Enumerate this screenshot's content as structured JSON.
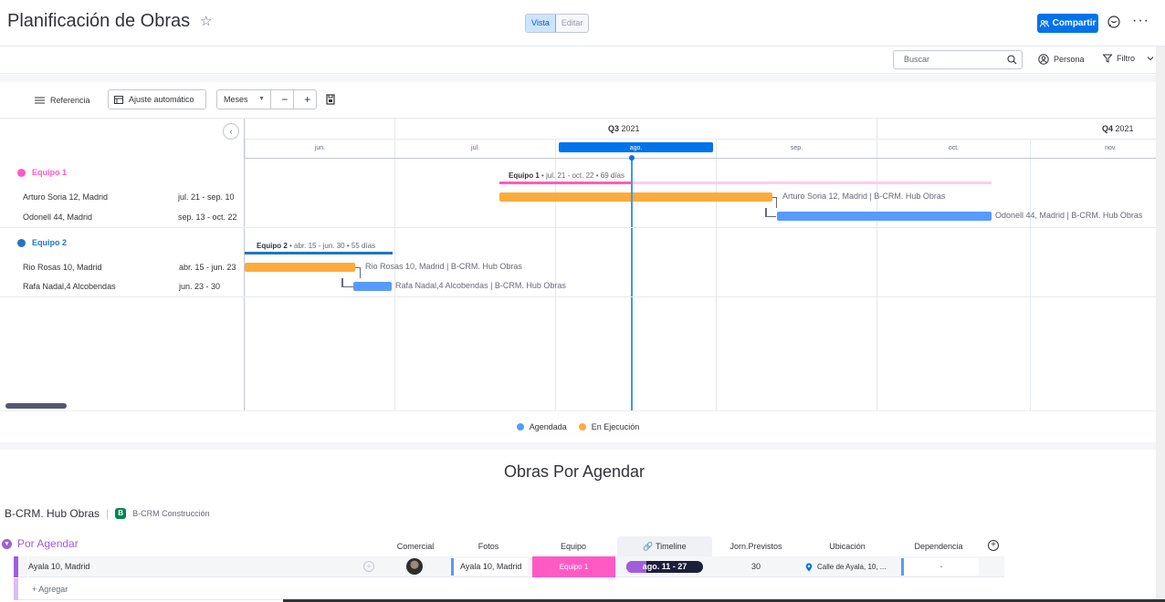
{
  "header": {
    "title": "Planificación de Obras",
    "view_toggle": [
      "Vista",
      "Editar"
    ],
    "share_label": "Compartir",
    "more": "···"
  },
  "toolbar": {
    "search_placeholder": "Buscar",
    "person_label": "Persona",
    "filter_label": "Filtro"
  },
  "gantt_toolbar": {
    "reference_label": "Referencia",
    "auto_fit_label": "Ajuste automático",
    "scale_label": "Meses",
    "zoom_out": "−",
    "zoom_in": "+"
  },
  "gantt": {
    "quarters": [
      {
        "name": "Q3",
        "year": "2021"
      },
      {
        "name": "Q4",
        "year": "2021"
      }
    ],
    "months": [
      "jun.",
      "jul.",
      "ago.",
      "sep.",
      "oct.",
      "nov."
    ],
    "current_month": "ago.",
    "groups": [
      {
        "name": "Equipo 1",
        "color": "#ff5ac4",
        "summary_name": "Equipo 1",
        "summary_detail": " • jul. 21 - oct. 22 • 69 días",
        "items": [
          {
            "name": "Arturo Soria 12, Madrid",
            "dates": "jul. 21 - sep. 10",
            "bar_label": "Arturo Soria 12, Madrid | B-CRM. Hub Obras",
            "status": "En Ejecución"
          },
          {
            "name": "Odonell 44, Madrid",
            "dates": "sep. 13 - oct. 22",
            "bar_label": "Odonell 44, Madrid | B-CRM. Hub Obras",
            "status": "Agendada"
          }
        ]
      },
      {
        "name": "Equipo 2",
        "color": "#1f76c2",
        "summary_name": "Equipo 2",
        "summary_detail": " • abr. 15 - jun. 30 • 55 días",
        "items": [
          {
            "name": "Rio Rosas 10, Madrid",
            "dates": "abr. 15 - jun. 23",
            "bar_label": "Rio Rosas 10, Madrid | B-CRM. Hub Obras",
            "status": "En Ejecución"
          },
          {
            "name": "Rafa Nadal,4 Alcobendas",
            "dates": "jun. 23 - 30",
            "bar_label": "Rafa Nadal,4 Alcobendas | B-CRM. Hub Obras",
            "status": "Agendada"
          }
        ]
      }
    ],
    "legend": [
      {
        "label": "Agendada",
        "color": "#579bfc"
      },
      {
        "label": "En Ejecución",
        "color": "#fdab3d"
      }
    ]
  },
  "board": {
    "section_title": "Obras Por Agendar",
    "board_name": "B-CRM. Hub Obras",
    "workspace_badge": "B",
    "workspace_name": "B-CRM Construcción",
    "group_name": "Por Agendar",
    "columns": [
      "Comercial",
      "Fotos",
      "Equipo",
      "Timeline",
      "Jorn.Previstos",
      "Ubicación",
      "Dependencia"
    ],
    "rows": [
      {
        "name": "Ayala 10, Madrid",
        "fotos": "Ayala 10, Madrid",
        "equipo": "Equipo 1",
        "timeline": "ago. 11 - 27",
        "jornadas": "30",
        "ubicacion": "Calle de Ayala, 10, ...",
        "dependencia": "-"
      }
    ],
    "add_label": "+ Agregar"
  }
}
